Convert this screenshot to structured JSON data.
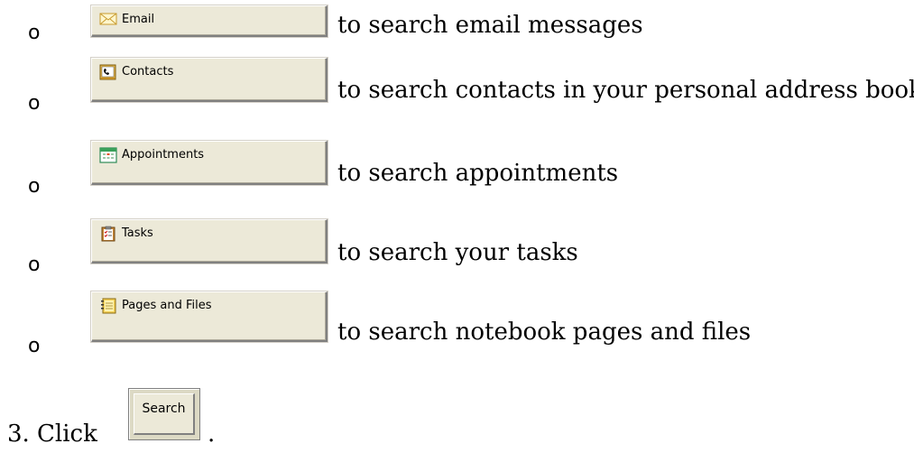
{
  "filters": [
    {
      "bullet": "o",
      "button_label": "Email",
      "icon": "envelope-icon",
      "description": "to search email messages"
    },
    {
      "bullet": "o",
      "button_label": "Contacts",
      "icon": "address-card-icon",
      "description": "to search contacts in your personal address book"
    },
    {
      "bullet": "o",
      "button_label": "Appointments",
      "icon": "calendar-icon",
      "description": "to search appointments"
    },
    {
      "bullet": "o",
      "button_label": "Tasks",
      "icon": "clipboard-checklist-icon",
      "description": "to search your tasks"
    },
    {
      "bullet": "o",
      "button_label": "Pages and Files",
      "icon": "notebook-icon",
      "description": "to search notebook pages and files"
    }
  ],
  "step": {
    "number": "3.",
    "text": "Click",
    "button_label": "Search",
    "trailing": "."
  }
}
